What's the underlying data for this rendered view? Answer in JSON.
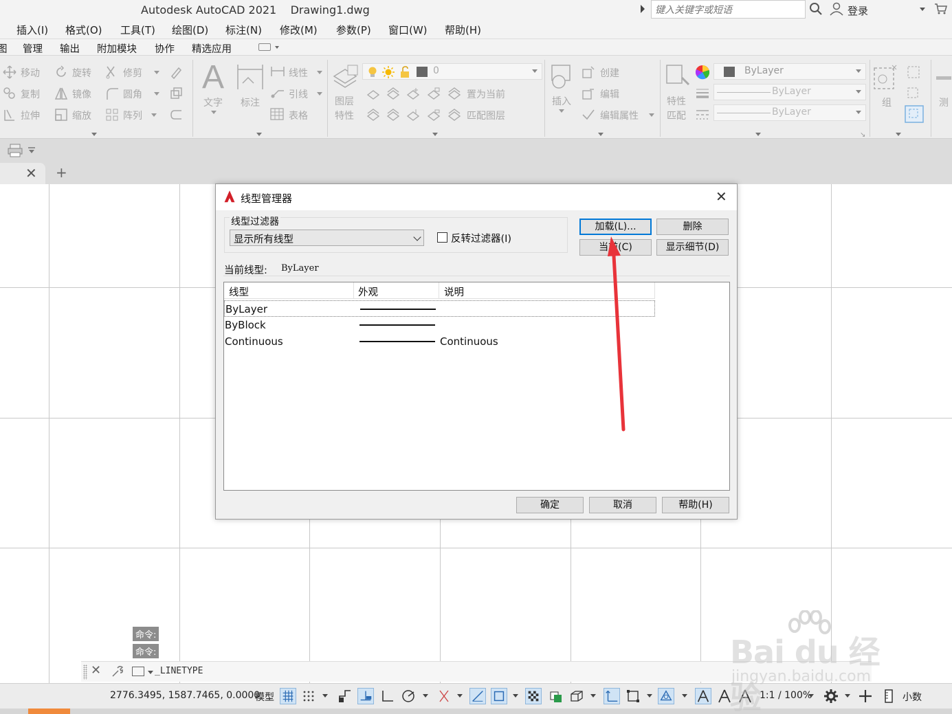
{
  "window": {
    "title": "Autodesk AutoCAD 2021    Drawing1.dwg",
    "search_placeholder": "键入关键字或短语",
    "login_label": "登录"
  },
  "menubar": {
    "items": [
      "插入(I)",
      "格式(O)",
      "工具(T)",
      "绘图(D)",
      "标注(N)",
      "修改(M)",
      "参数(P)",
      "窗口(W)",
      "帮助(H)"
    ]
  },
  "ribbon_tabs": {
    "items": [
      "图",
      "管理",
      "输出",
      "附加模块",
      "协作",
      "精选应用"
    ]
  },
  "ribbon": {
    "modify": {
      "move": "移动",
      "rotate": "旋转",
      "trim": "修剪",
      "copy": "复制",
      "mirror": "镜像",
      "fillet": "圆角",
      "stretch": "拉伸",
      "scale": "缩放",
      "array": "阵列"
    },
    "annotation": {
      "text": "文字",
      "dimension": "标注",
      "linear": "线性",
      "leader": "引线",
      "table": "表格"
    },
    "layers": {
      "layer_props": "图层\n特性",
      "layer_props_line1": "图层",
      "layer_props_line2": "特性",
      "current_layer": "0",
      "set_current": "置为当前",
      "match_layer": "匹配图层"
    },
    "block": {
      "insert": "插入",
      "create": "创建",
      "edit": "编辑",
      "edit_attributes": "编辑属性"
    },
    "properties": {
      "match_line1": "特性",
      "match_line2": "匹配",
      "color": "ByLayer",
      "lineweight": "ByLayer",
      "linetype": "ByLayer"
    },
    "groups": {
      "group": "组",
      "measure": "测"
    }
  },
  "command_history": [
    "命令:",
    "命令:"
  ],
  "command_line": {
    "text": "_LINETYPE"
  },
  "statusbar": {
    "coords": "2776.3495, 1587.7465, 0.0000",
    "model": "模型",
    "scale": "1:1 / 100%",
    "units": "小数"
  },
  "dialog": {
    "title": "线型管理器",
    "filter_label": "线型过滤器",
    "filter_value": "显示所有线型",
    "invert_filter": "反转过滤器(I)",
    "buttons": {
      "load": "加载(L)...",
      "delete": "删除",
      "current": "当前(C)",
      "show_details": "显示细节(D)",
      "ok": "确定",
      "cancel": "取消",
      "help": "帮助(H)"
    },
    "current_linetype_label": "当前线型:",
    "current_linetype_value": "ByLayer",
    "columns": [
      "线型",
      "外观",
      "说明"
    ],
    "rows": [
      {
        "name": "ByLayer",
        "description": ""
      },
      {
        "name": "ByBlock",
        "description": ""
      },
      {
        "name": "Continuous",
        "description": "Continuous"
      }
    ]
  },
  "watermark": {
    "brand": "Bai du 经验",
    "url": "jingyan.baidu.com"
  },
  "colors": {
    "accent_blue": "#0078d7",
    "arrow_red": "#e8333a",
    "status_orange": "#f08a3c"
  }
}
